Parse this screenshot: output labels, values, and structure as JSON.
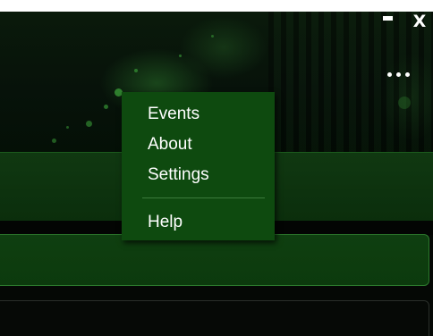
{
  "window": {
    "minimize_glyph": "—",
    "close_label": "X",
    "more_label": "More options"
  },
  "menu": {
    "items": [
      {
        "label": "Events"
      },
      {
        "label": "About"
      },
      {
        "label": "Settings"
      },
      {
        "label": "Help"
      }
    ]
  },
  "colors": {
    "menu_background": "#0e4a0f",
    "menu_text": "#ffffff",
    "accent_green": "#2c7a2d",
    "window_background": "#050805"
  },
  "icons": [
    "minimize-icon",
    "close-icon",
    "more-dots-icon"
  ]
}
